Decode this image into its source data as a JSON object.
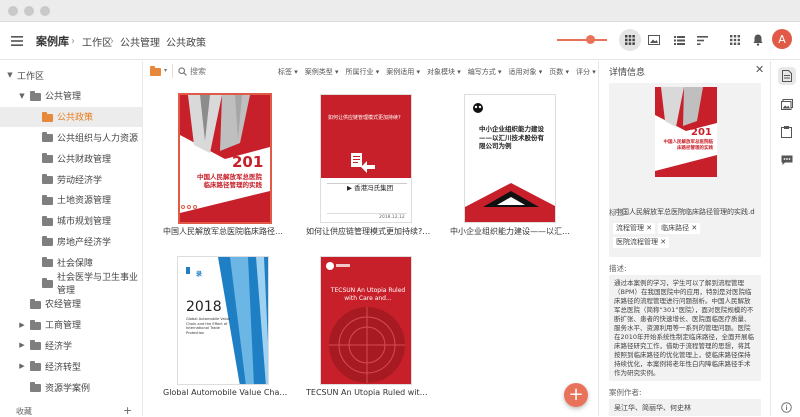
{
  "app": {
    "title": "案例库"
  },
  "breadcrumb": [
    "工作区",
    "公共管理",
    "公共政策"
  ],
  "user": {
    "avatar_letter": "A",
    "avatar_color": "#e05a47"
  },
  "sidebar": {
    "items": [
      {
        "label": "工作区",
        "level": 0,
        "expanded": true,
        "has_arrow": true,
        "folder": false
      },
      {
        "label": "公共管理",
        "level": 1,
        "expanded": true,
        "has_arrow": true,
        "folder": true
      },
      {
        "label": "公共政策",
        "level": 2,
        "selected": true,
        "folder": true
      },
      {
        "label": "公共组织与人力资源",
        "level": 2,
        "folder": true
      },
      {
        "label": "公共财政管理",
        "level": 2,
        "folder": true
      },
      {
        "label": "劳动经济学",
        "level": 2,
        "folder": true
      },
      {
        "label": "土地资源管理",
        "level": 2,
        "folder": true
      },
      {
        "label": "城市规划管理",
        "level": 2,
        "folder": true
      },
      {
        "label": "房地产经济学",
        "level": 2,
        "folder": true
      },
      {
        "label": "社会保障",
        "level": 2,
        "folder": true
      },
      {
        "label": "社会医学与卫生事业管理",
        "level": 2,
        "folder": true
      },
      {
        "label": "农经管理",
        "level": 1,
        "folder": true
      },
      {
        "label": "工商管理",
        "level": 1,
        "has_arrow": true,
        "expanded": false,
        "folder": true
      },
      {
        "label": "经济学",
        "level": 1,
        "has_arrow": true,
        "expanded": false,
        "folder": true
      },
      {
        "label": "经济转型",
        "level": 1,
        "has_arrow": true,
        "expanded": false,
        "folder": true
      },
      {
        "label": "资源学案例",
        "level": 1,
        "folder": true
      }
    ],
    "bottom_label": "收藏",
    "bottom_add": "+"
  },
  "search": {
    "placeholder": "搜索"
  },
  "filters": [
    "标签",
    "案例类型",
    "所属行业",
    "案例适用",
    "对象模块",
    "编写方式",
    "适用对象",
    "页数",
    "评分"
  ],
  "cards": [
    {
      "title": "中国人民解放军总医院临床路径管理的...",
      "cover": "red-building",
      "number": "201",
      "cover_text": "中国人民解放军总医院临床路径管理的实践"
    },
    {
      "title": "如何让供应链管理模式更加持续? —...",
      "cover": "red-arrow",
      "cover_text": "如何让供应链管理模式更加持续?",
      "brand": "香港冯氏集团",
      "date": "2018.12.12"
    },
    {
      "title": "中小企业组织能力建设——以汇川技术...",
      "cover": "white-text",
      "cover_text": "中小企业组织能力建设——以汇川技术股份有限公司为例"
    },
    {
      "title": "Global Automobile Value Chain and the...",
      "cover": "blue-building",
      "number": "2018",
      "cover_text": "Global Automobile Value Chain and the Effect of International Trade Protection"
    },
    {
      "title": "TECSUN An Utopia Ruled with Care an...",
      "cover": "red-globe",
      "cover_text": "TECSUN An Utopia Ruled with Care and..."
    }
  ],
  "fab_label": "+",
  "panel": {
    "title": "详情信息",
    "filename": "中国人民解放军总医院临床路径管理的实践.docx",
    "tags_label": "标签:",
    "tags": [
      "流程管理",
      "临床路径",
      "医院流程管理"
    ],
    "desc_label": "描述:",
    "description": "通过本案例的学习，学生可以了解到流程管理（BPM）在我国医院中的应用，特别是对医院临床路径的流程管理进行问题剖析。中国人民解放军总医院（简称“301”医院），面对医院规模的不断扩张、患者的快速增长、医院面临医疗质量、服务水平、资源利用等一系列的管理问题。医院在2010年开始系统性制定临床路径，全面开展临床路径研究工作，借助于流程管理的思想，将其按照到临床路径的优化管理上，使临床路径保持持续优化，本案例将老年性白内障临床路径手术作为研究实例。",
    "author_label": "案例作者:",
    "authors": "吴江华、简丽华、何史林"
  },
  "colors": {
    "accent": "#e8735a",
    "orange": "#e8883a",
    "red": "#c8202a"
  }
}
